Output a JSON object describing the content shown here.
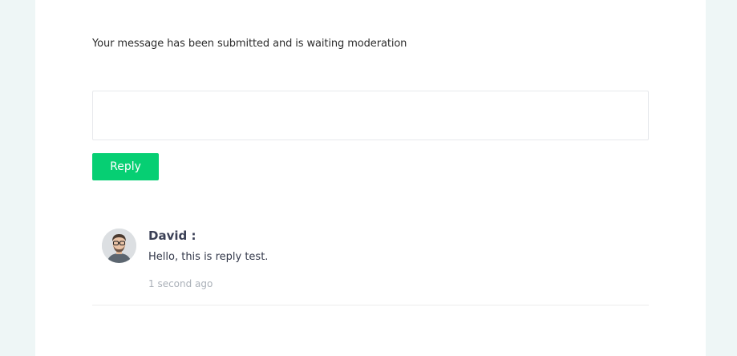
{
  "status": {
    "message": "Your message has been submitted and is waiting moderation"
  },
  "reply_form": {
    "textarea_value": "",
    "button_label": "Reply"
  },
  "comments": [
    {
      "author": "David :",
      "text": "Hello, this is reply test.",
      "time": "1 second ago",
      "avatar_icon": "user-avatar-icon"
    }
  ],
  "colors": {
    "accent": "#06cf73",
    "background": "#eef6f6",
    "panel": "#ffffff"
  }
}
